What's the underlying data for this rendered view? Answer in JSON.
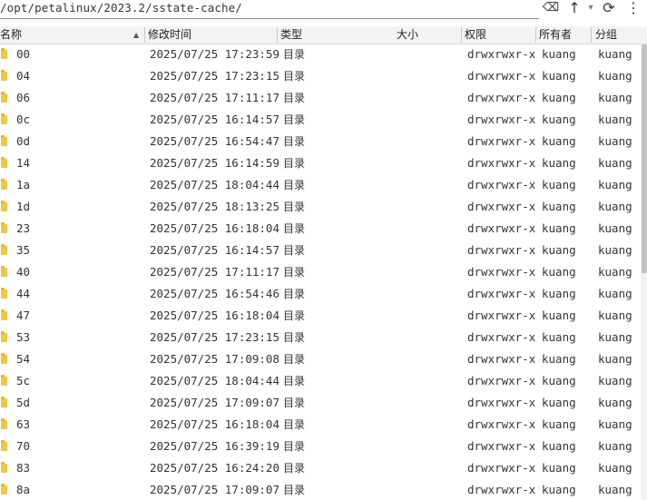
{
  "path": {
    "value": "/opt/petalinux/2023.2/sstate-cache/"
  },
  "toolbar": {
    "clear_icon": "⌫",
    "up_icon": "↑",
    "history_icon": "▾",
    "refresh_icon": "⟳",
    "menu_icon": "⋮"
  },
  "columns": {
    "name": "名称",
    "mtime": "修改时间",
    "type": "类型",
    "size": "大小",
    "perms": "权限",
    "owner": "所有者",
    "group": "分组"
  },
  "sort_icon": "▲",
  "rows": [
    {
      "name": "00",
      "mtime": "2025/07/25 17:23:59",
      "type": "目录",
      "perms": "drwxrwxr-x",
      "owner": "kuang",
      "group": "kuang"
    },
    {
      "name": "04",
      "mtime": "2025/07/25 17:23:15",
      "type": "目录",
      "perms": "drwxrwxr-x",
      "owner": "kuang",
      "group": "kuang"
    },
    {
      "name": "06",
      "mtime": "2025/07/25 17:11:17",
      "type": "目录",
      "perms": "drwxrwxr-x",
      "owner": "kuang",
      "group": "kuang"
    },
    {
      "name": "0c",
      "mtime": "2025/07/25 16:14:57",
      "type": "目录",
      "perms": "drwxrwxr-x",
      "owner": "kuang",
      "group": "kuang"
    },
    {
      "name": "0d",
      "mtime": "2025/07/25 16:54:47",
      "type": "目录",
      "perms": "drwxrwxr-x",
      "owner": "kuang",
      "group": "kuang"
    },
    {
      "name": "14",
      "mtime": "2025/07/25 16:14:59",
      "type": "目录",
      "perms": "drwxrwxr-x",
      "owner": "kuang",
      "group": "kuang"
    },
    {
      "name": "1a",
      "mtime": "2025/07/25 18:04:44",
      "type": "目录",
      "perms": "drwxrwxr-x",
      "owner": "kuang",
      "group": "kuang"
    },
    {
      "name": "1d",
      "mtime": "2025/07/25 18:13:25",
      "type": "目录",
      "perms": "drwxrwxr-x",
      "owner": "kuang",
      "group": "kuang"
    },
    {
      "name": "23",
      "mtime": "2025/07/25 16:18:04",
      "type": "目录",
      "perms": "drwxrwxr-x",
      "owner": "kuang",
      "group": "kuang"
    },
    {
      "name": "35",
      "mtime": "2025/07/25 16:14:57",
      "type": "目录",
      "perms": "drwxrwxr-x",
      "owner": "kuang",
      "group": "kuang"
    },
    {
      "name": "40",
      "mtime": "2025/07/25 17:11:17",
      "type": "目录",
      "perms": "drwxrwxr-x",
      "owner": "kuang",
      "group": "kuang"
    },
    {
      "name": "44",
      "mtime": "2025/07/25 16:54:46",
      "type": "目录",
      "perms": "drwxrwxr-x",
      "owner": "kuang",
      "group": "kuang"
    },
    {
      "name": "47",
      "mtime": "2025/07/25 16:18:04",
      "type": "目录",
      "perms": "drwxrwxr-x",
      "owner": "kuang",
      "group": "kuang"
    },
    {
      "name": "53",
      "mtime": "2025/07/25 17:23:15",
      "type": "目录",
      "perms": "drwxrwxr-x",
      "owner": "kuang",
      "group": "kuang"
    },
    {
      "name": "54",
      "mtime": "2025/07/25 17:09:08",
      "type": "目录",
      "perms": "drwxrwxr-x",
      "owner": "kuang",
      "group": "kuang"
    },
    {
      "name": "5c",
      "mtime": "2025/07/25 18:04:44",
      "type": "目录",
      "perms": "drwxrwxr-x",
      "owner": "kuang",
      "group": "kuang"
    },
    {
      "name": "5d",
      "mtime": "2025/07/25 17:09:07",
      "type": "目录",
      "perms": "drwxrwxr-x",
      "owner": "kuang",
      "group": "kuang"
    },
    {
      "name": "63",
      "mtime": "2025/07/25 16:18:04",
      "type": "目录",
      "perms": "drwxrwxr-x",
      "owner": "kuang",
      "group": "kuang"
    },
    {
      "name": "70",
      "mtime": "2025/07/25 16:39:19",
      "type": "目录",
      "perms": "drwxrwxr-x",
      "owner": "kuang",
      "group": "kuang"
    },
    {
      "name": "83",
      "mtime": "2025/07/25 16:24:20",
      "type": "目录",
      "perms": "drwxrwxr-x",
      "owner": "kuang",
      "group": "kuang"
    },
    {
      "name": "8a",
      "mtime": "2025/07/25 17:09:07",
      "type": "目录",
      "perms": "drwxrwxr-x",
      "owner": "kuang",
      "group": "kuang"
    }
  ],
  "row_icon": "folder-icon",
  "colors": {
    "folder": "#f5c542",
    "header_bg": "#f3f3f3",
    "scroll_thumb": "#c1c1c1"
  }
}
